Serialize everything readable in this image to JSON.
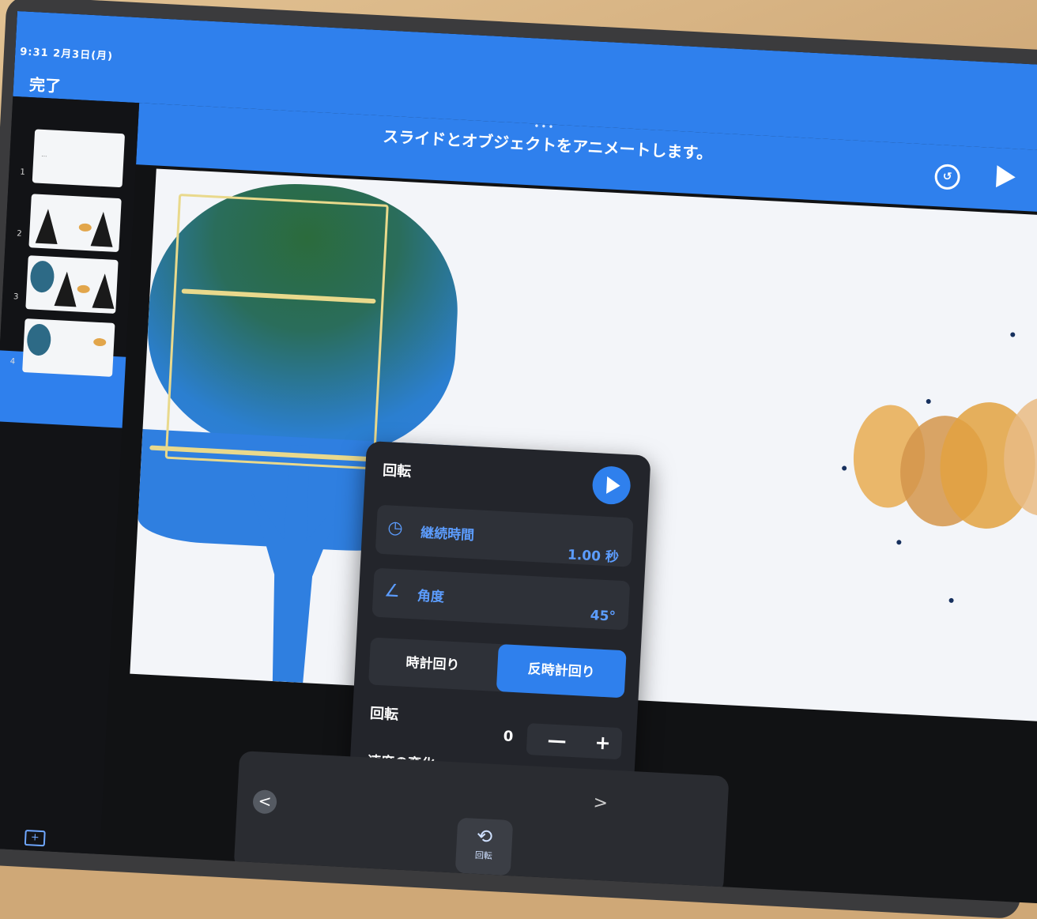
{
  "status": {
    "time_date": "9:31 2月3日(月)"
  },
  "toolbar": {
    "done_label": "完了",
    "hint": "スライドとオブジェクトをアニメートします。",
    "grip": "•••"
  },
  "slides": [
    {
      "num": "1",
      "caption": "…"
    },
    {
      "num": "2"
    },
    {
      "num": "3"
    },
    {
      "num": "4"
    }
  ],
  "icons": {
    "undo": "undo-icon",
    "play": "play-icon",
    "add": "add-slide-icon"
  },
  "popover": {
    "title": "回転",
    "duration_label": "継続時間",
    "duration_value": "1.00 秒",
    "angle_label": "角度",
    "angle_value": "45°",
    "clockwise": "時計回り",
    "counterclockwise": "反時計回り",
    "rotations_label": "回転",
    "rotations_value": "0",
    "minus": "—",
    "plus": "+",
    "speed_label": "速度の変化"
  },
  "bottom": {
    "tool_label": "回転",
    "prev": "<",
    "next": ">"
  },
  "colors": {
    "accent": "#2f80ed",
    "panel": "#23252b"
  }
}
